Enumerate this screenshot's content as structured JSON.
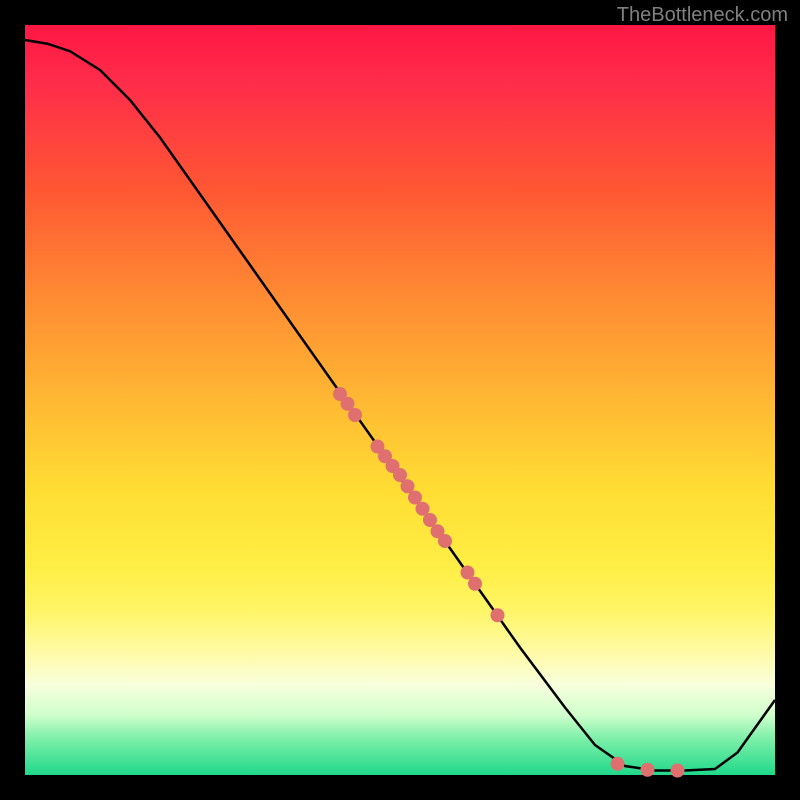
{
  "watermark": "TheBottleneck.com",
  "chart_data": {
    "type": "line",
    "title": "",
    "xlabel": "",
    "ylabel": "",
    "xlim": [
      0,
      100
    ],
    "ylim": [
      0,
      100
    ],
    "curve": [
      {
        "x": 0,
        "y": 98
      },
      {
        "x": 3,
        "y": 97.5
      },
      {
        "x": 6,
        "y": 96.5
      },
      {
        "x": 10,
        "y": 94
      },
      {
        "x": 14,
        "y": 90
      },
      {
        "x": 18,
        "y": 85
      },
      {
        "x": 24,
        "y": 76.5
      },
      {
        "x": 30,
        "y": 68
      },
      {
        "x": 36,
        "y": 59.5
      },
      {
        "x": 42,
        "y": 51
      },
      {
        "x": 48,
        "y": 42.5
      },
      {
        "x": 54,
        "y": 34
      },
      {
        "x": 60,
        "y": 25.5
      },
      {
        "x": 66,
        "y": 17
      },
      {
        "x": 72,
        "y": 9
      },
      {
        "x": 76,
        "y": 4
      },
      {
        "x": 80,
        "y": 1.2
      },
      {
        "x": 84,
        "y": 0.6
      },
      {
        "x": 88,
        "y": 0.6
      },
      {
        "x": 92,
        "y": 0.8
      },
      {
        "x": 95,
        "y": 3
      },
      {
        "x": 100,
        "y": 10
      }
    ],
    "markers": [
      {
        "x": 42,
        "y": 50.8
      },
      {
        "x": 43,
        "y": 49.5
      },
      {
        "x": 44,
        "y": 48
      },
      {
        "x": 47,
        "y": 43.8
      },
      {
        "x": 48,
        "y": 42.5
      },
      {
        "x": 49,
        "y": 41.2
      },
      {
        "x": 50,
        "y": 40
      },
      {
        "x": 51,
        "y": 38.5
      },
      {
        "x": 52,
        "y": 37
      },
      {
        "x": 53,
        "y": 35.5
      },
      {
        "x": 54,
        "y": 34
      },
      {
        "x": 55,
        "y": 32.5
      },
      {
        "x": 56,
        "y": 31.2
      },
      {
        "x": 59,
        "y": 27
      },
      {
        "x": 60,
        "y": 25.5
      },
      {
        "x": 63,
        "y": 21.3
      },
      {
        "x": 79,
        "y": 1.5
      },
      {
        "x": 83,
        "y": 0.7
      },
      {
        "x": 87,
        "y": 0.6
      }
    ],
    "marker_color": "#e07070",
    "curve_color": "#000000"
  }
}
